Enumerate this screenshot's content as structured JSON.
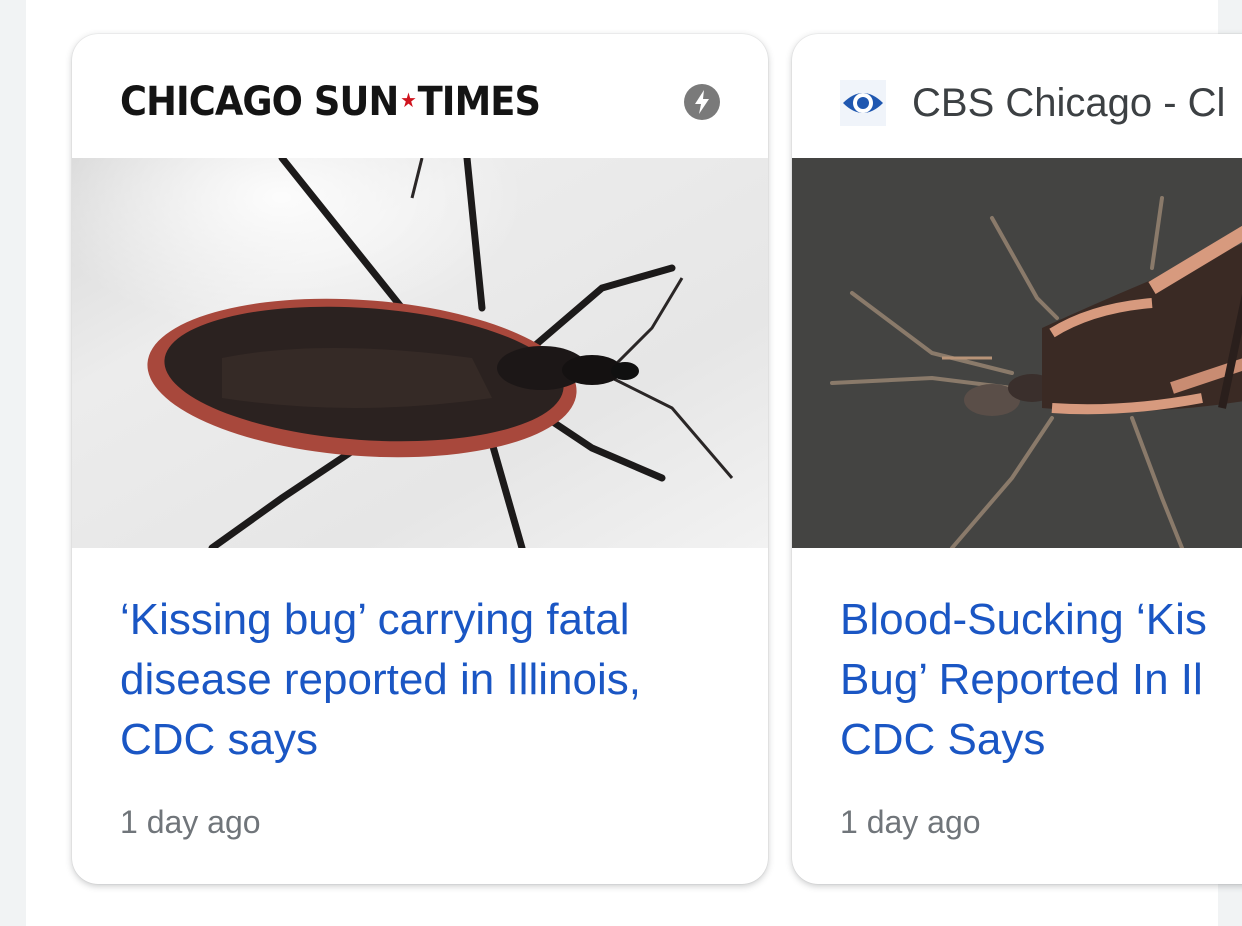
{
  "cards": [
    {
      "source": "CHICAGO SUN-TIMES",
      "source_parts": [
        "CHICAGO SUN",
        "TIMES"
      ],
      "source_separator": "★",
      "badge_icon": "amp-lightning-icon",
      "image": "kissing-bug-photo-light-background",
      "headline": "‘Kissing bug’ carrying fatal disease reported in Illinois, CDC says",
      "time": "1 day ago"
    },
    {
      "source": "CBS Chicago - Cl",
      "source_icon": "cbs-eye-icon",
      "image": "kissing-bug-photo-dark-background",
      "headline": "Blood-Sucking ‘Kis\nBug’ Reported In Il\nCDC Says",
      "time": "1 day ago"
    }
  ],
  "colors": {
    "headline": "#1a56c4",
    "timestamp": "#70757a",
    "source_text": "#3c4043",
    "masthead_accent": "#d0141e",
    "cbs_blue": "#1f57b0"
  }
}
